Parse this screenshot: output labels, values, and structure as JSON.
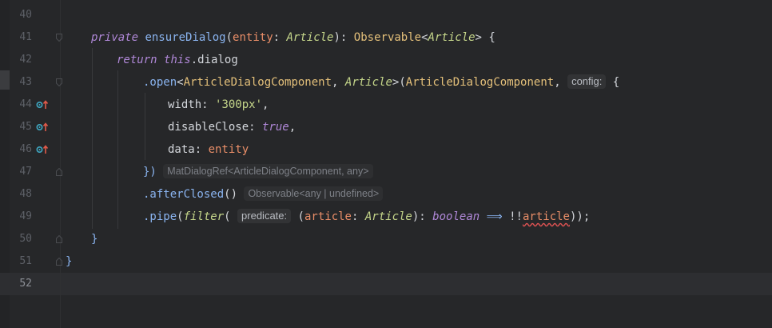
{
  "editor": {
    "lines": [
      {
        "num": "40"
      },
      {
        "num": "41",
        "private_kw": "private",
        "method": "ensureDialog",
        "p1": "(",
        "param": "entity",
        "colon": ": ",
        "ptype": "Article",
        "p2": "): ",
        "rtype": "Observable",
        "lt": "<",
        "rtypearg": "Article",
        "gt": ">",
        "brace": " {"
      },
      {
        "num": "42",
        "return_kw": "return",
        "sp": " ",
        "this_kw": "this",
        "dot": ".",
        "prop": "dialog"
      },
      {
        "num": "43",
        "dot_open": ".open",
        "lt": "<",
        "t1": "ArticleDialogComponent",
        "comma": ", ",
        "t2": "Article",
        "gt": ">(",
        "arg": "ArticleDialogComponent",
        "comma2": ", ",
        "hint": "config:",
        "brace": " {"
      },
      {
        "num": "44",
        "key": "width",
        "colon": ": ",
        "val": "'300px'",
        "comma": ","
      },
      {
        "num": "45",
        "key": "disableClose",
        "colon": ": ",
        "val": "true",
        "comma": ","
      },
      {
        "num": "46",
        "key": "data",
        "colon": ": ",
        "val": "entity"
      },
      {
        "num": "47",
        "close": "})",
        "hint": "MatDialogRef<ArticleDialogComponent, any>"
      },
      {
        "num": "48",
        "call": ".afterClosed",
        "paren": "()",
        "hint": "Observable<any | undefined>"
      },
      {
        "num": "49",
        "call": ".pipe",
        "p1": "(",
        "fn": "filter",
        "p2": "( ",
        "hint": "predicate:",
        "p3": " (",
        "arg": "article",
        "colon": ": ",
        "type": "Article",
        "p4": "): ",
        "rtype": "boolean",
        "arrow": " ⟹ ",
        "bang": "!!",
        "ref": "article",
        "end": "));"
      },
      {
        "num": "50",
        "brace": "}"
      },
      {
        "num": "51",
        "brace": "}"
      },
      {
        "num": "52"
      }
    ]
  }
}
